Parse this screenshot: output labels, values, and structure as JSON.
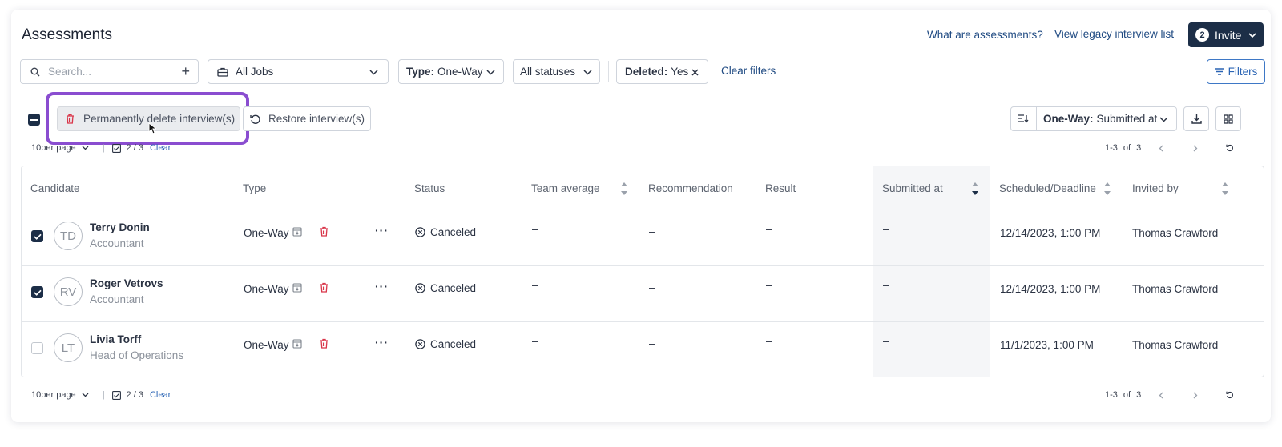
{
  "header": {
    "title": "Assessments",
    "what_are_link": "What are assessments?",
    "legacy_link": "View legacy interview list",
    "invite_count": "2",
    "invite_label": "Invite"
  },
  "filters": {
    "search_placeholder": "Search...",
    "jobs_value": "All Jobs",
    "type_label": "Type:",
    "type_value": "One-Way",
    "statuses_value": "All statuses",
    "deleted_label": "Deleted:",
    "deleted_value": "Yes",
    "clear_filters": "Clear filters",
    "filters_button": "Filters"
  },
  "actions": {
    "delete_label": "Permanently delete interview(s)",
    "restore_label": "Restore interview(s)",
    "sort_prefix": "One-Way:",
    "sort_value": "Submitted at"
  },
  "pagination": {
    "per_page_num": "10",
    "per_page_text": "per page",
    "selected": "2 / 3",
    "clear": "Clear",
    "range": "1-3",
    "of": "of",
    "total": "3"
  },
  "table": {
    "columns": {
      "candidate": "Candidate",
      "type": "Type",
      "status": "Status",
      "team_average": "Team average",
      "recommendation": "Recommendation",
      "result": "Result",
      "submitted_at": "Submitted at",
      "scheduled": "Scheduled/Deadline",
      "invited_by": "Invited by"
    },
    "rows": [
      {
        "initials": "TD",
        "name": "Terry Donin",
        "role": "Accountant",
        "type": "One-Way",
        "status": "Canceled",
        "team_average": "–",
        "recommendation": "–",
        "result": "–",
        "submitted_at": "–",
        "scheduled": "12/14/2023, 1:00 PM",
        "invited_by": "Thomas Crawford"
      },
      {
        "initials": "RV",
        "name": "Roger Vetrovs",
        "role": "Accountant",
        "type": "One-Way",
        "status": "Canceled",
        "team_average": "–",
        "recommendation": "–",
        "result": "–",
        "submitted_at": "–",
        "scheduled": "12/14/2023, 1:00 PM",
        "invited_by": "Thomas Crawford"
      },
      {
        "initials": "LT",
        "name": "Livia Torff",
        "role": "Head of Operations",
        "type": "One-Way",
        "status": "Canceled",
        "team_average": "–",
        "recommendation": "–",
        "result": "–",
        "submitted_at": "–",
        "scheduled": "11/1/2023, 1:00 PM",
        "invited_by": "Thomas Crawford"
      }
    ]
  },
  "colors": {
    "accent_dark": "#1c2e47",
    "link_blue": "#1f4a82",
    "highlight_purple": "#8a4dd0",
    "delete_red": "#d9364a"
  }
}
